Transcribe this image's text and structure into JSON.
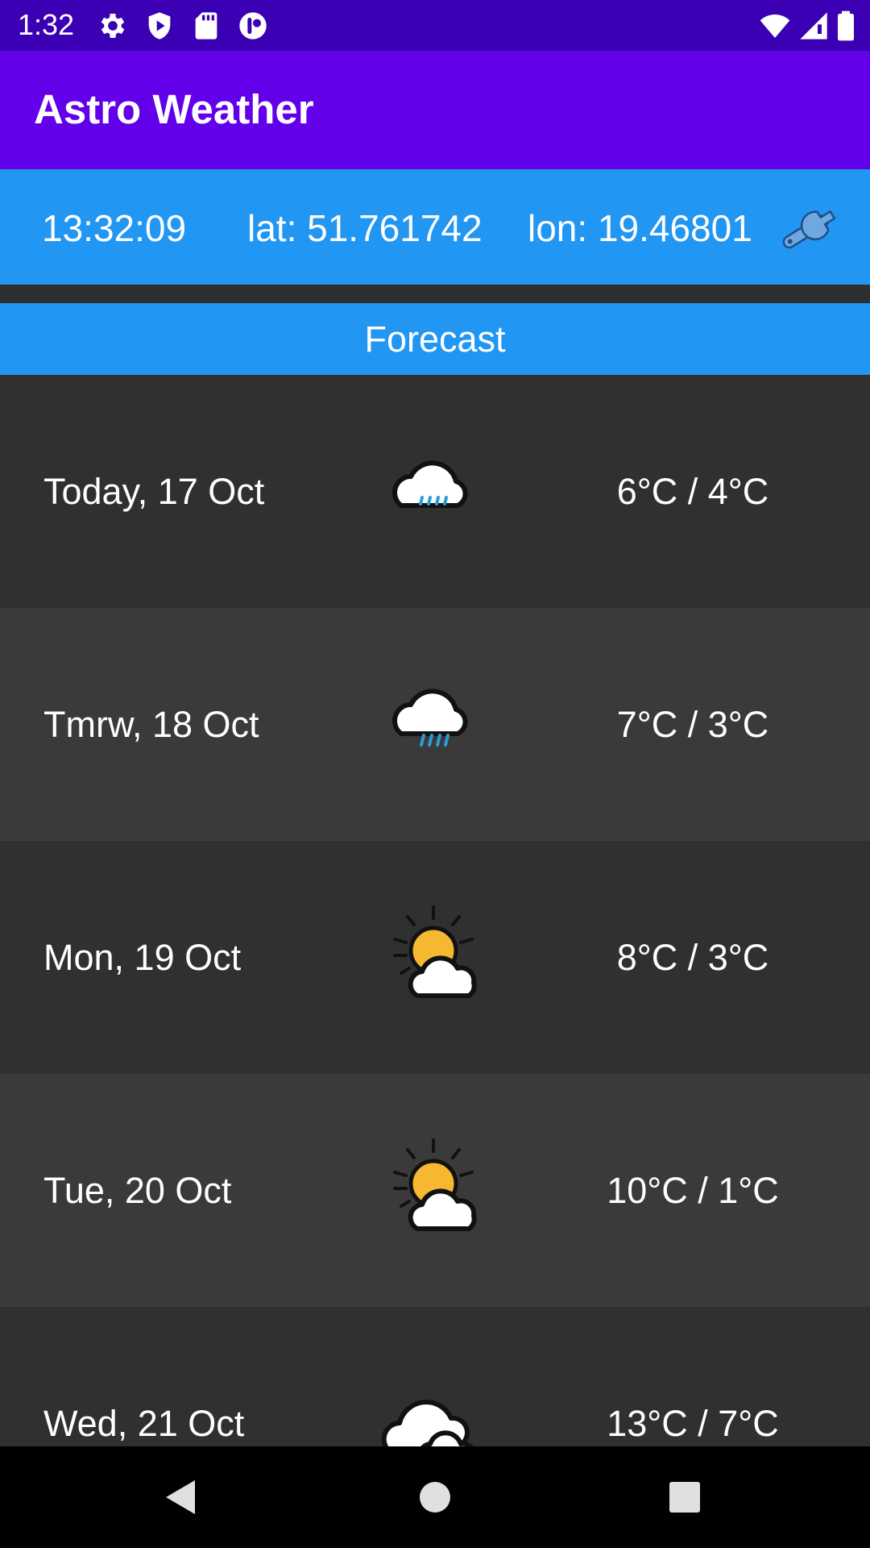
{
  "status_bar": {
    "time": "1:32",
    "left_icons": [
      "settings-gear-icon",
      "shield-play-icon",
      "sd-card-icon",
      "app-notification-icon"
    ],
    "right_icons": [
      "wifi-icon",
      "cellular-signal-icon",
      "battery-icon"
    ]
  },
  "app_bar": {
    "title": "Astro Weather",
    "color": "#6200ea"
  },
  "info_bar": {
    "time": "13:32:09",
    "lat": "lat: 51.761742",
    "lon": "lon: 19.46801",
    "settings_icon": "wrench-icon",
    "color": "#2196f3"
  },
  "forecast": {
    "header": "Forecast",
    "days": [
      {
        "date": "Today, 17 Oct",
        "icon": "light-rain-icon",
        "temp": "6°C / 4°C"
      },
      {
        "date": "Tmrw, 18 Oct",
        "icon": "rain-icon",
        "temp": "7°C / 3°C"
      },
      {
        "date": "Mon, 19 Oct",
        "icon": "partly-cloudy-icon",
        "temp": "8°C / 3°C"
      },
      {
        "date": "Tue, 20 Oct",
        "icon": "partly-cloudy-icon",
        "temp": "10°C / 1°C"
      },
      {
        "date": "Wed, 21 Oct",
        "icon": "cloudy-icon",
        "temp": "13°C / 7°C"
      }
    ]
  },
  "nav_bar": {
    "buttons": [
      "back-icon",
      "home-icon",
      "recents-icon"
    ]
  }
}
